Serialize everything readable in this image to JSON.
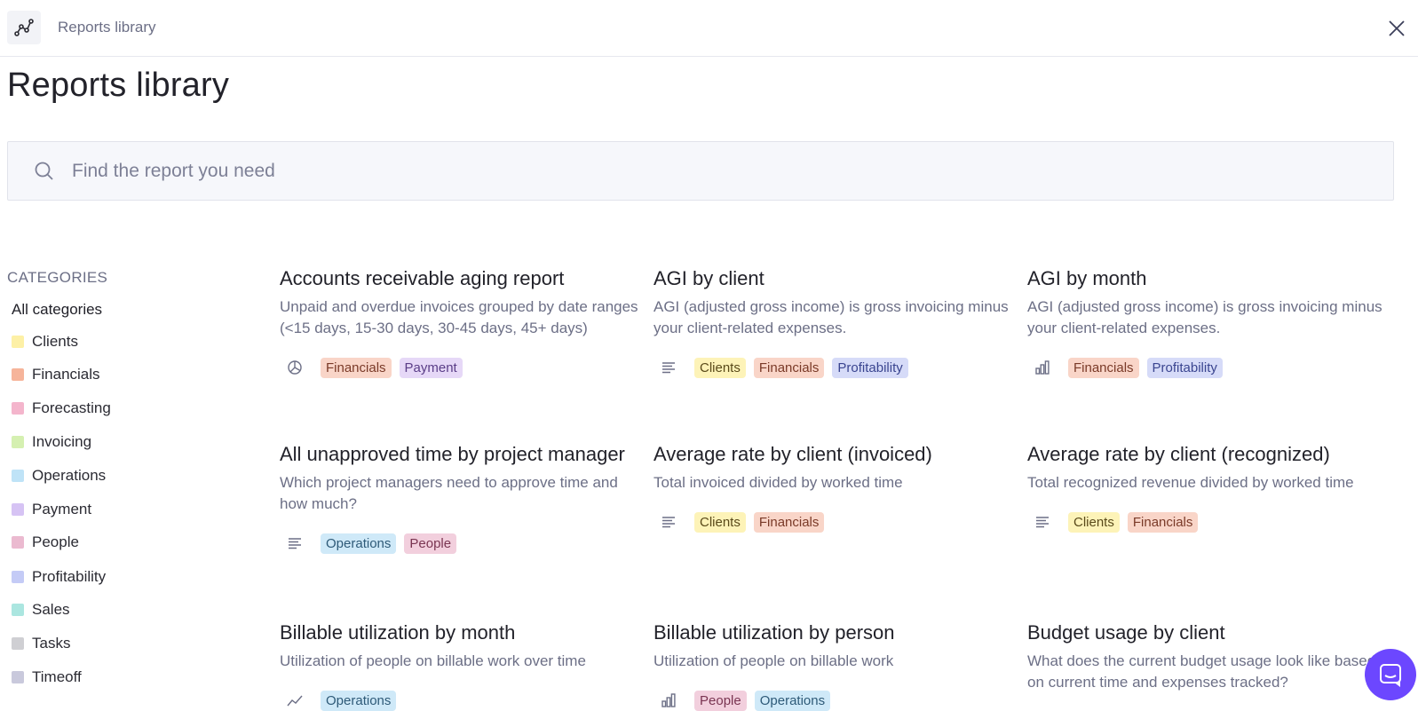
{
  "header": {
    "app_title": "Reports library",
    "logo_icon": "line-chart-icon",
    "close_icon": "close-icon"
  },
  "page": {
    "title": "Reports library"
  },
  "search": {
    "placeholder": "Find the report you need",
    "value": ""
  },
  "categories": {
    "heading": "CATEGORIES",
    "all_label": "All categories",
    "items": [
      {
        "label": "Clients",
        "color": "#fdf0a6"
      },
      {
        "label": "Financials",
        "color": "#f6b49a"
      },
      {
        "label": "Forecasting",
        "color": "#f4b5cc"
      },
      {
        "label": "Invoicing",
        "color": "#d5f0b1"
      },
      {
        "label": "Operations",
        "color": "#bfe3f7"
      },
      {
        "label": "Payment",
        "color": "#d6c3f4"
      },
      {
        "label": "People",
        "color": "#ebbad0"
      },
      {
        "label": "Profitability",
        "color": "#c4cbf6"
      },
      {
        "label": "Sales",
        "color": "#abe6e0"
      },
      {
        "label": "Tasks",
        "color": "#cfcfd3"
      },
      {
        "label": "Timeoff",
        "color": "#c9c9dc"
      }
    ]
  },
  "tag_colors": {
    "Clients": {
      "bg": "#fdf3b8",
      "fg": "#5a4a1a"
    },
    "Financials": {
      "bg": "#f9d5c8",
      "fg": "#7a3a28"
    },
    "Profitability": {
      "bg": "#d6dbf8",
      "fg": "#3a4590"
    },
    "Payment": {
      "bg": "#e6d8f7",
      "fg": "#5a3d87"
    },
    "Operations": {
      "bg": "#cfe9f8",
      "fg": "#2e5a78"
    },
    "People": {
      "bg": "#f2cfdd",
      "fg": "#7a3552"
    }
  },
  "reports": [
    {
      "title": "Accounts receivable aging report",
      "description": "Unpaid and overdue invoices grouped by date ranges (<15 days, 15-30 days, 30-45 days, 45+ days)",
      "type_icon": "pie-chart-icon",
      "tags": [
        "Financials",
        "Payment"
      ]
    },
    {
      "title": "AGI by client",
      "description": "AGI (adjusted gross income) is gross invoicing minus your client-related expenses.",
      "type_icon": "table-icon",
      "tags": [
        "Clients",
        "Financials",
        "Profitability"
      ]
    },
    {
      "title": "AGI by month",
      "description": "AGI (adjusted gross income) is gross invoicing minus your client-related expenses.",
      "type_icon": "bar-chart-icon",
      "tags": [
        "Financials",
        "Profitability"
      ]
    },
    {
      "title": "All unapproved time by project manager",
      "description": "Which project managers need to approve time and how much?",
      "type_icon": "table-icon",
      "tags": [
        "Operations",
        "People"
      ]
    },
    {
      "title": "Average rate by client (invoiced)",
      "description": "Total invoiced divided by worked time",
      "type_icon": "table-icon",
      "tags": [
        "Clients",
        "Financials"
      ]
    },
    {
      "title": "Average rate by client (recognized)",
      "description": "Total recognized revenue divided by worked time",
      "type_icon": "table-icon",
      "tags": [
        "Clients",
        "Financials"
      ]
    },
    {
      "title": "Billable utilization by month",
      "description": "Utilization of people on billable work over time",
      "type_icon": "line-chart-icon",
      "tags": [
        "Operations"
      ]
    },
    {
      "title": "Billable utilization by person",
      "description": "Utilization of people on billable work",
      "type_icon": "bar-chart-icon",
      "tags": [
        "People",
        "Operations"
      ]
    },
    {
      "title": "Budget usage by client",
      "description": "What does the current budget usage look like based on current time and expenses tracked?",
      "type_icon": "table-icon",
      "tags": []
    }
  ],
  "chat": {
    "icon": "chat-bubble-icon"
  }
}
